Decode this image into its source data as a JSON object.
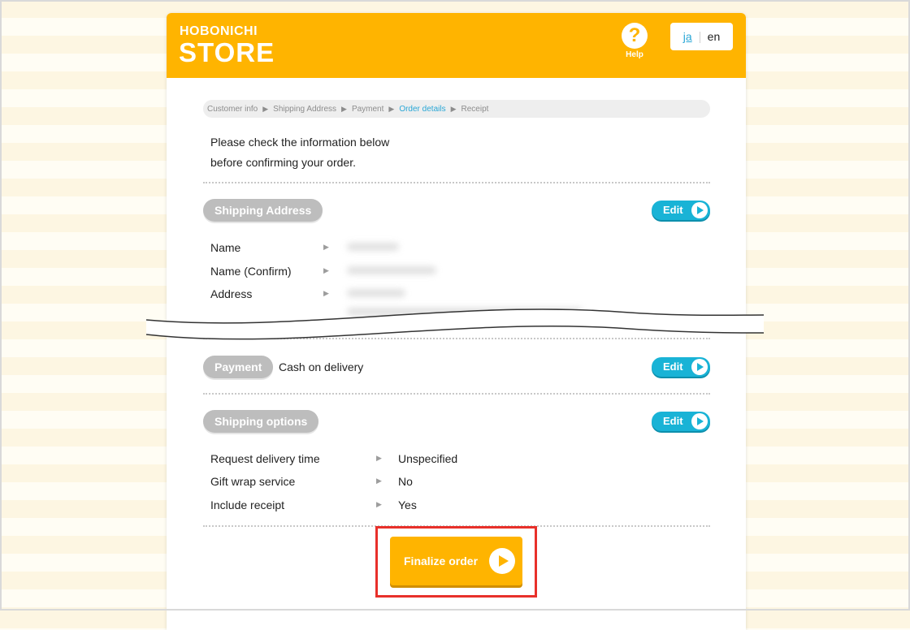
{
  "header": {
    "logo_line1": "HOBONICHI",
    "logo_line2": "STORE",
    "help_icon": "?",
    "help_label": "Help",
    "lang_ja": "ja",
    "lang_en": "en"
  },
  "breadcrumb": {
    "steps": [
      "Customer info",
      "Shipping Address",
      "Payment",
      "Order details",
      "Receipt"
    ],
    "active_index": 3,
    "arrow": "▶"
  },
  "intro": {
    "line1": "Please check the information below",
    "line2": "before confirming your order."
  },
  "shipping_address": {
    "title": "Shipping Address",
    "edit_label": "Edit",
    "rows": [
      {
        "label": "Name",
        "arrow": "▶"
      },
      {
        "label": "Name (Confirm)",
        "arrow": "▶"
      },
      {
        "label": "Address",
        "arrow": "▶"
      }
    ]
  },
  "payment": {
    "title": "Payment",
    "value": "Cash on delivery",
    "edit_label": "Edit"
  },
  "shipping_options": {
    "title": "Shipping options",
    "edit_label": "Edit",
    "rows": [
      {
        "label": "Request delivery time",
        "arrow": "▶",
        "value": "Unspecified"
      },
      {
        "label": "Gift wrap service",
        "arrow": "▶",
        "value": "No"
      },
      {
        "label": "Include receipt",
        "arrow": "▶",
        "value": "Yes"
      }
    ]
  },
  "finalize": {
    "label": "Finalize order"
  },
  "colors": {
    "brand": "#ffb400",
    "accent": "#19b3d6",
    "pill": "#bdbdbd",
    "highlight": "#e8302a"
  },
  "icons": {
    "help": "help-icon",
    "edit_play": "play-circle-icon",
    "finalize_play": "play-circle-icon"
  }
}
